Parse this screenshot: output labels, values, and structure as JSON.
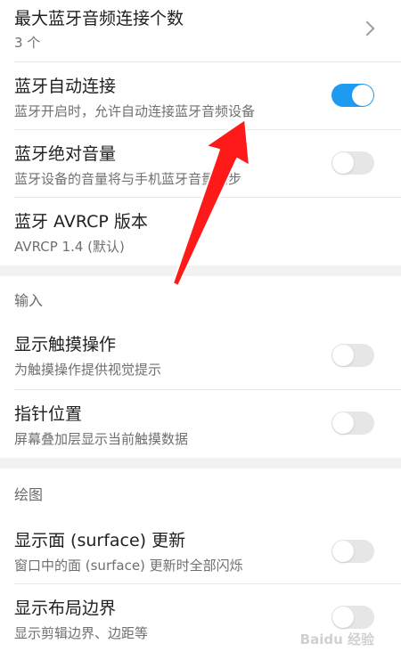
{
  "bluetooth": {
    "max_devices": {
      "title": "最大蓝牙音频连接个数",
      "subtitle": "3 个"
    },
    "auto_connect": {
      "title": "蓝牙自动连接",
      "subtitle": "蓝牙开启时，允许自动连接蓝牙音频设备",
      "enabled": true
    },
    "absolute_volume": {
      "title": "蓝牙绝对音量",
      "subtitle": "蓝牙设备的音量将与手机蓝牙音量同步",
      "enabled": false
    },
    "avrcp": {
      "title": "蓝牙 AVRCP 版本",
      "subtitle": "AVRCP 1.4 (默认)"
    }
  },
  "input": {
    "header": "输入",
    "show_taps": {
      "title": "显示触摸操作",
      "subtitle": "为触摸操作提供视觉提示",
      "enabled": false
    },
    "pointer_location": {
      "title": "指针位置",
      "subtitle": "屏幕叠加层显示当前触摸数据",
      "enabled": false
    }
  },
  "drawing": {
    "header": "绘图",
    "surface_updates": {
      "title": "显示面 (surface) 更新",
      "subtitle": "窗口中的面 (surface) 更新时全部闪烁",
      "enabled": false
    },
    "layout_bounds": {
      "title": "显示布局边界",
      "subtitle": "显示剪辑边界、边距等",
      "enabled": false
    }
  },
  "annotation": {
    "color": "#ff1a1a"
  },
  "watermark": {
    "text": "Baidu 经验"
  },
  "colors": {
    "accent": "#1e9bf0",
    "switch_off": "#e6e6e6",
    "section_gap": "#f2f2f2"
  }
}
